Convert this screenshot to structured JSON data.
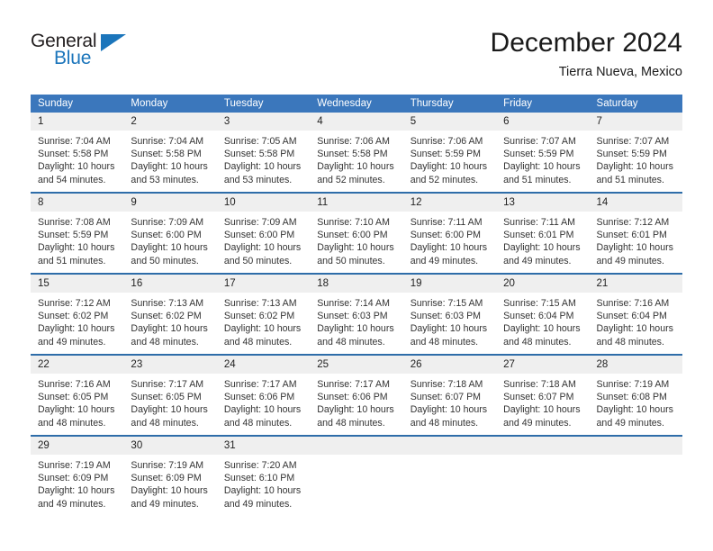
{
  "brand": {
    "name_part1": "General",
    "name_part2": "Blue"
  },
  "header": {
    "title": "December 2024",
    "subtitle": "Tierra Nueva, Mexico"
  },
  "colors": {
    "header_blue": "#3b77bc",
    "separator_blue": "#2e6da9",
    "daynum_band": "#efefef",
    "brand_blue": "#1b75bb",
    "text": "#333333"
  },
  "weekdays": [
    "Sunday",
    "Monday",
    "Tuesday",
    "Wednesday",
    "Thursday",
    "Friday",
    "Saturday"
  ],
  "weeks": [
    [
      {
        "day": "1",
        "sunrise": "Sunrise: 7:04 AM",
        "sunset": "Sunset: 5:58 PM",
        "daylight": "Daylight: 10 hours and 54 minutes."
      },
      {
        "day": "2",
        "sunrise": "Sunrise: 7:04 AM",
        "sunset": "Sunset: 5:58 PM",
        "daylight": "Daylight: 10 hours and 53 minutes."
      },
      {
        "day": "3",
        "sunrise": "Sunrise: 7:05 AM",
        "sunset": "Sunset: 5:58 PM",
        "daylight": "Daylight: 10 hours and 53 minutes."
      },
      {
        "day": "4",
        "sunrise": "Sunrise: 7:06 AM",
        "sunset": "Sunset: 5:58 PM",
        "daylight": "Daylight: 10 hours and 52 minutes."
      },
      {
        "day": "5",
        "sunrise": "Sunrise: 7:06 AM",
        "sunset": "Sunset: 5:59 PM",
        "daylight": "Daylight: 10 hours and 52 minutes."
      },
      {
        "day": "6",
        "sunrise": "Sunrise: 7:07 AM",
        "sunset": "Sunset: 5:59 PM",
        "daylight": "Daylight: 10 hours and 51 minutes."
      },
      {
        "day": "7",
        "sunrise": "Sunrise: 7:07 AM",
        "sunset": "Sunset: 5:59 PM",
        "daylight": "Daylight: 10 hours and 51 minutes."
      }
    ],
    [
      {
        "day": "8",
        "sunrise": "Sunrise: 7:08 AM",
        "sunset": "Sunset: 5:59 PM",
        "daylight": "Daylight: 10 hours and 51 minutes."
      },
      {
        "day": "9",
        "sunrise": "Sunrise: 7:09 AM",
        "sunset": "Sunset: 6:00 PM",
        "daylight": "Daylight: 10 hours and 50 minutes."
      },
      {
        "day": "10",
        "sunrise": "Sunrise: 7:09 AM",
        "sunset": "Sunset: 6:00 PM",
        "daylight": "Daylight: 10 hours and 50 minutes."
      },
      {
        "day": "11",
        "sunrise": "Sunrise: 7:10 AM",
        "sunset": "Sunset: 6:00 PM",
        "daylight": "Daylight: 10 hours and 50 minutes."
      },
      {
        "day": "12",
        "sunrise": "Sunrise: 7:11 AM",
        "sunset": "Sunset: 6:00 PM",
        "daylight": "Daylight: 10 hours and 49 minutes."
      },
      {
        "day": "13",
        "sunrise": "Sunrise: 7:11 AM",
        "sunset": "Sunset: 6:01 PM",
        "daylight": "Daylight: 10 hours and 49 minutes."
      },
      {
        "day": "14",
        "sunrise": "Sunrise: 7:12 AM",
        "sunset": "Sunset: 6:01 PM",
        "daylight": "Daylight: 10 hours and 49 minutes."
      }
    ],
    [
      {
        "day": "15",
        "sunrise": "Sunrise: 7:12 AM",
        "sunset": "Sunset: 6:02 PM",
        "daylight": "Daylight: 10 hours and 49 minutes."
      },
      {
        "day": "16",
        "sunrise": "Sunrise: 7:13 AM",
        "sunset": "Sunset: 6:02 PM",
        "daylight": "Daylight: 10 hours and 48 minutes."
      },
      {
        "day": "17",
        "sunrise": "Sunrise: 7:13 AM",
        "sunset": "Sunset: 6:02 PM",
        "daylight": "Daylight: 10 hours and 48 minutes."
      },
      {
        "day": "18",
        "sunrise": "Sunrise: 7:14 AM",
        "sunset": "Sunset: 6:03 PM",
        "daylight": "Daylight: 10 hours and 48 minutes."
      },
      {
        "day": "19",
        "sunrise": "Sunrise: 7:15 AM",
        "sunset": "Sunset: 6:03 PM",
        "daylight": "Daylight: 10 hours and 48 minutes."
      },
      {
        "day": "20",
        "sunrise": "Sunrise: 7:15 AM",
        "sunset": "Sunset: 6:04 PM",
        "daylight": "Daylight: 10 hours and 48 minutes."
      },
      {
        "day": "21",
        "sunrise": "Sunrise: 7:16 AM",
        "sunset": "Sunset: 6:04 PM",
        "daylight": "Daylight: 10 hours and 48 minutes."
      }
    ],
    [
      {
        "day": "22",
        "sunrise": "Sunrise: 7:16 AM",
        "sunset": "Sunset: 6:05 PM",
        "daylight": "Daylight: 10 hours and 48 minutes."
      },
      {
        "day": "23",
        "sunrise": "Sunrise: 7:17 AM",
        "sunset": "Sunset: 6:05 PM",
        "daylight": "Daylight: 10 hours and 48 minutes."
      },
      {
        "day": "24",
        "sunrise": "Sunrise: 7:17 AM",
        "sunset": "Sunset: 6:06 PM",
        "daylight": "Daylight: 10 hours and 48 minutes."
      },
      {
        "day": "25",
        "sunrise": "Sunrise: 7:17 AM",
        "sunset": "Sunset: 6:06 PM",
        "daylight": "Daylight: 10 hours and 48 minutes."
      },
      {
        "day": "26",
        "sunrise": "Sunrise: 7:18 AM",
        "sunset": "Sunset: 6:07 PM",
        "daylight": "Daylight: 10 hours and 48 minutes."
      },
      {
        "day": "27",
        "sunrise": "Sunrise: 7:18 AM",
        "sunset": "Sunset: 6:07 PM",
        "daylight": "Daylight: 10 hours and 49 minutes."
      },
      {
        "day": "28",
        "sunrise": "Sunrise: 7:19 AM",
        "sunset": "Sunset: 6:08 PM",
        "daylight": "Daylight: 10 hours and 49 minutes."
      }
    ],
    [
      {
        "day": "29",
        "sunrise": "Sunrise: 7:19 AM",
        "sunset": "Sunset: 6:09 PM",
        "daylight": "Daylight: 10 hours and 49 minutes."
      },
      {
        "day": "30",
        "sunrise": "Sunrise: 7:19 AM",
        "sunset": "Sunset: 6:09 PM",
        "daylight": "Daylight: 10 hours and 49 minutes."
      },
      {
        "day": "31",
        "sunrise": "Sunrise: 7:20 AM",
        "sunset": "Sunset: 6:10 PM",
        "daylight": "Daylight: 10 hours and 49 minutes."
      },
      {
        "day": "",
        "sunrise": "",
        "sunset": "",
        "daylight": ""
      },
      {
        "day": "",
        "sunrise": "",
        "sunset": "",
        "daylight": ""
      },
      {
        "day": "",
        "sunrise": "",
        "sunset": "",
        "daylight": ""
      },
      {
        "day": "",
        "sunrise": "",
        "sunset": "",
        "daylight": ""
      }
    ]
  ]
}
